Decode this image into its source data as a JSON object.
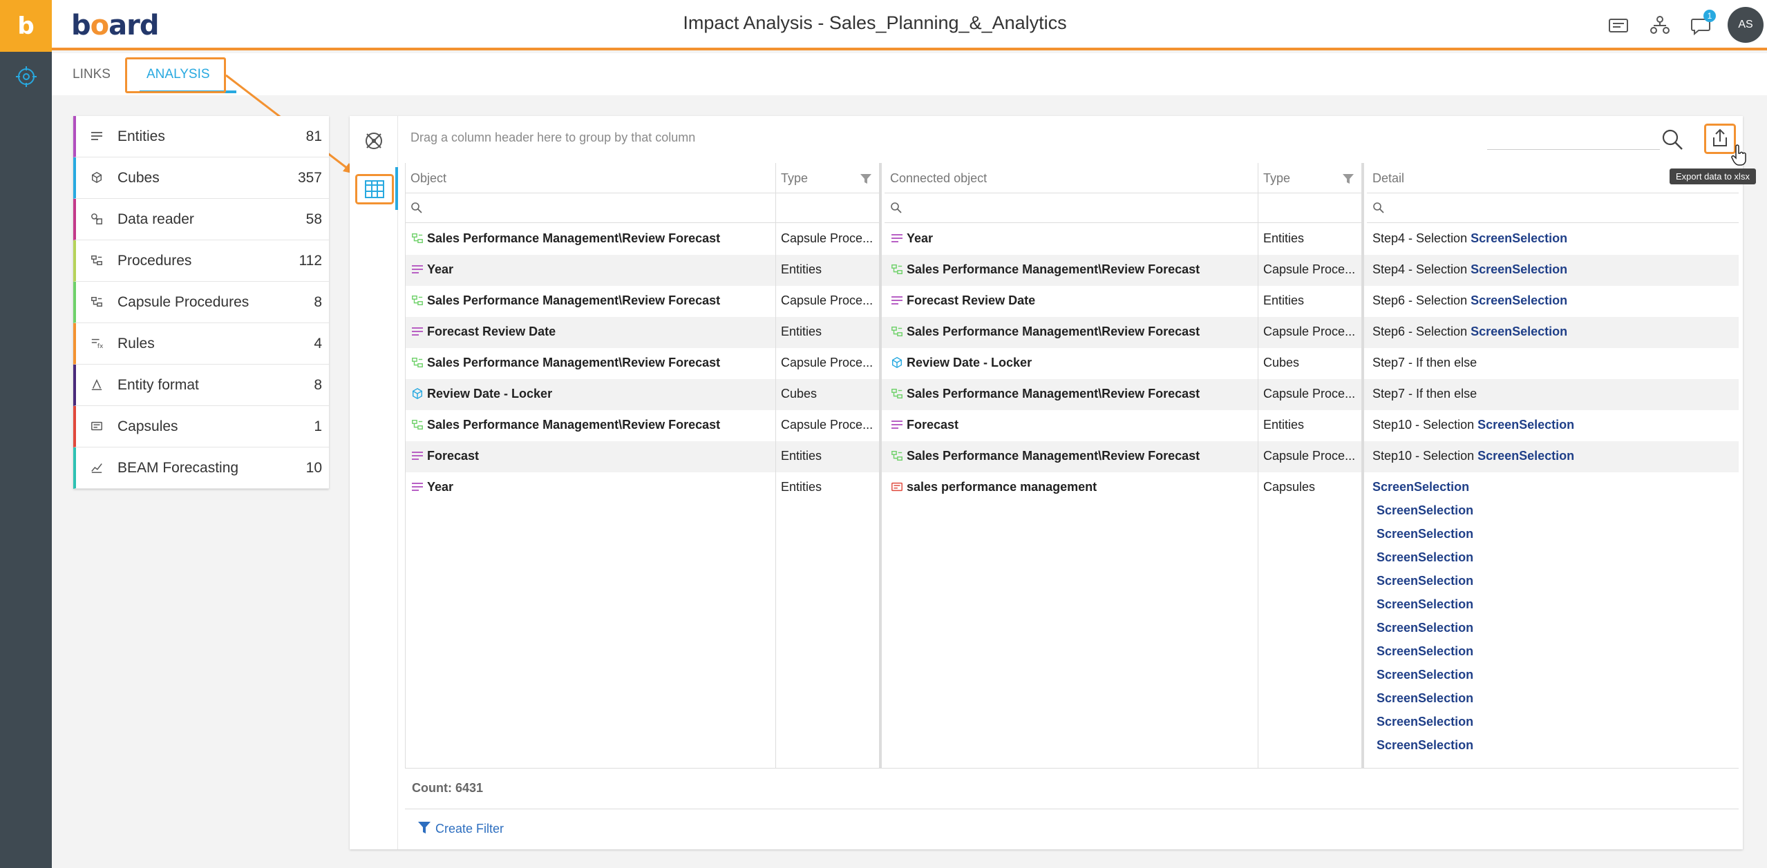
{
  "rail": {
    "logo": "b"
  },
  "header": {
    "brand_pre": "b",
    "brand_o": "o",
    "brand_post": "ard",
    "title": "Impact Analysis - Sales_Planning_&_Analytics",
    "notifications_count": "1",
    "avatar_initials": "AS"
  },
  "tabs": [
    {
      "label": "LINKS"
    },
    {
      "label": "ANALYSIS"
    }
  ],
  "categories": [
    {
      "label": "Entities",
      "count": "81",
      "color": "#b14fbf",
      "icon": "entities-icon"
    },
    {
      "label": "Cubes",
      "count": "357",
      "color": "#28a9e0",
      "icon": "cube-icon"
    },
    {
      "label": "Data reader",
      "count": "58",
      "color": "#c33a8a",
      "icon": "data-reader-icon"
    },
    {
      "label": "Procedures",
      "count": "112",
      "color": "#b6d35a",
      "icon": "procedure-icon"
    },
    {
      "label": "Capsule Procedures",
      "count": "8",
      "color": "#6fd16a",
      "icon": "capsule-procedure-icon"
    },
    {
      "label": "Rules",
      "count": "4",
      "color": "#f39231",
      "icon": "rules-icon"
    },
    {
      "label": "Entity format",
      "count": "8",
      "color": "#4a2a7a",
      "icon": "entity-format-icon"
    },
    {
      "label": "Capsules",
      "count": "1",
      "color": "#e0493c",
      "icon": "capsule-icon"
    },
    {
      "label": "BEAM Forecasting",
      "count": "10",
      "color": "#2ec1b3",
      "icon": "forecast-icon"
    }
  ],
  "grid": {
    "group_hint": "Drag a column header here to group by that column",
    "tooltip": "Export data to xlsx",
    "columns": [
      "Object",
      "Type",
      "Connected object",
      "Type",
      "Detail"
    ],
    "rows": [
      {
        "object": "Sales Performance Management\\Review Forecast",
        "obj_icon": "capsule-procedure-icon",
        "type": "Capsule Proce...",
        "connected": "Year",
        "conn_icon": "entities-icon",
        "ctype": "Entities",
        "detail": "Step4 - Selection",
        "detail_ss": "ScreenSelection"
      },
      {
        "object": "Year",
        "obj_icon": "entities-icon",
        "type": "Entities",
        "connected": "Sales Performance Management\\Review Forecast",
        "conn_icon": "capsule-procedure-icon",
        "ctype": "Capsule Proce...",
        "detail": "Step4 - Selection",
        "detail_ss": "ScreenSelection"
      },
      {
        "object": "Sales Performance Management\\Review Forecast",
        "obj_icon": "capsule-procedure-icon",
        "type": "Capsule Proce...",
        "connected": "Forecast Review Date",
        "conn_icon": "entities-icon",
        "ctype": "Entities",
        "detail": "Step6 - Selection",
        "detail_ss": "ScreenSelection"
      },
      {
        "object": "Forecast Review Date",
        "obj_icon": "entities-icon",
        "type": "Entities",
        "connected": "Sales Performance Management\\Review Forecast",
        "conn_icon": "capsule-procedure-icon",
        "ctype": "Capsule Proce...",
        "detail": "Step6 - Selection",
        "detail_ss": "ScreenSelection"
      },
      {
        "object": "Sales Performance Management\\Review Forecast",
        "obj_icon": "capsule-procedure-icon",
        "type": "Capsule Proce...",
        "connected": "Review Date - Locker",
        "conn_icon": "cube-icon",
        "ctype": "Cubes",
        "detail": "Step7 - If then else",
        "detail_ss": ""
      },
      {
        "object": "Review Date - Locker",
        "obj_icon": "cube-icon",
        "type": "Cubes",
        "connected": "Sales Performance Management\\Review Forecast",
        "conn_icon": "capsule-procedure-icon",
        "ctype": "Capsule Proce...",
        "detail": "Step7 - If then else",
        "detail_ss": ""
      },
      {
        "object": "Sales Performance Management\\Review Forecast",
        "obj_icon": "capsule-procedure-icon",
        "type": "Capsule Proce...",
        "connected": "Forecast",
        "conn_icon": "entities-icon",
        "ctype": "Entities",
        "detail": "Step10 - Selection",
        "detail_ss": "ScreenSelection"
      },
      {
        "object": "Forecast",
        "obj_icon": "entities-icon",
        "type": "Entities",
        "connected": "Sales Performance Management\\Review Forecast",
        "conn_icon": "capsule-procedure-icon",
        "ctype": "Capsule Proce...",
        "detail": "Step10 - Selection",
        "detail_ss": "ScreenSelection"
      },
      {
        "object": "Year",
        "obj_icon": "entities-icon",
        "type": "Entities",
        "connected": "sales performance management",
        "conn_icon": "capsule-icon",
        "ctype": "Capsules",
        "detail": "",
        "detail_ss": "ScreenSelection"
      }
    ],
    "detail_extra": [
      "ScreenSelection",
      "ScreenSelection",
      "ScreenSelection",
      "ScreenSelection",
      "ScreenSelection",
      "ScreenSelection",
      "ScreenSelection",
      "ScreenSelection",
      "ScreenSelection",
      "ScreenSelection",
      "ScreenSelection",
      "ScreenSelection"
    ],
    "count_label": "Count: 6431",
    "create_filter": "Create Filter"
  },
  "colors": {
    "accent": "#f39231",
    "primary": "#28a9e0",
    "rail": "#3f4a52",
    "link_dark": "#1f3f88"
  }
}
